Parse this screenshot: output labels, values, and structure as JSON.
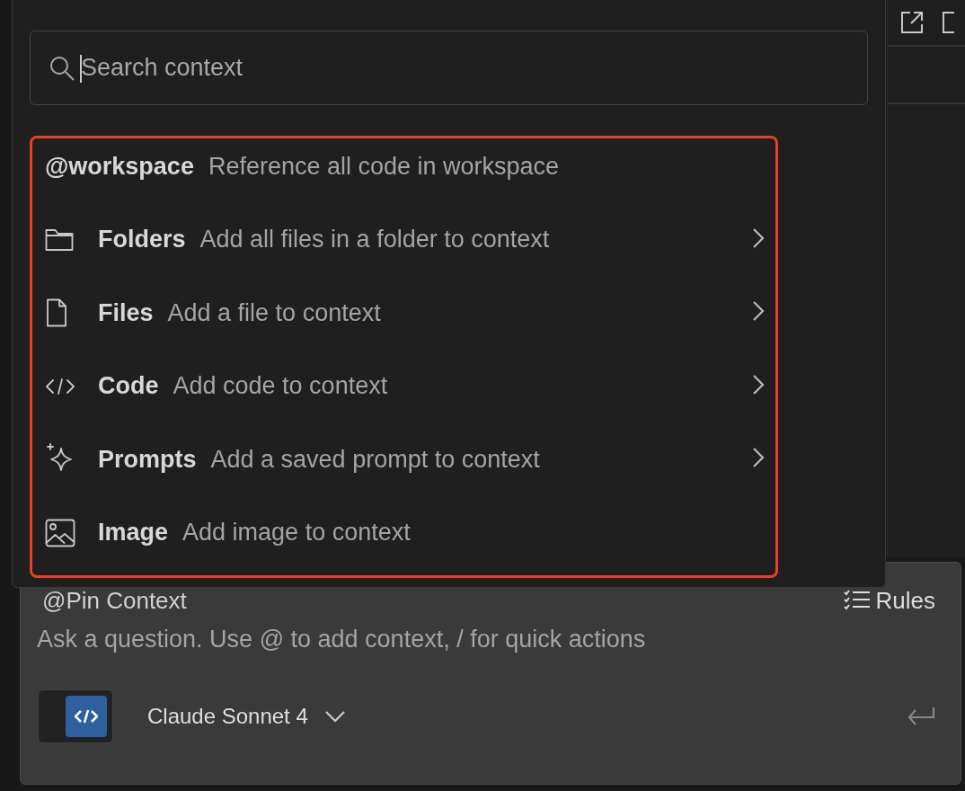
{
  "context_menu": {
    "search": {
      "placeholder": "Search context"
    },
    "items": [
      {
        "kind": "workspace",
        "title": "@workspace",
        "description": "Reference all code in workspace",
        "submenu": false
      },
      {
        "kind": "folder",
        "title": "Folders",
        "description": "Add all files in a folder to context",
        "submenu": true
      },
      {
        "kind": "file",
        "title": "Files",
        "description": "Add a file to context",
        "submenu": true
      },
      {
        "kind": "code",
        "title": "Code",
        "description": "Add code to context",
        "submenu": true
      },
      {
        "kind": "sparkle",
        "title": "Prompts",
        "description": "Add a saved prompt to context",
        "submenu": true
      },
      {
        "kind": "image",
        "title": "Image",
        "description": "Add image to context",
        "submenu": false
      }
    ]
  },
  "chat_input": {
    "pin_context": "@Pin Context",
    "rules": "Rules",
    "placeholder": "Ask a question. Use @ to add context, / for quick actions",
    "code_toggle": {
      "on": true
    },
    "model": "Claude Sonnet 4"
  }
}
